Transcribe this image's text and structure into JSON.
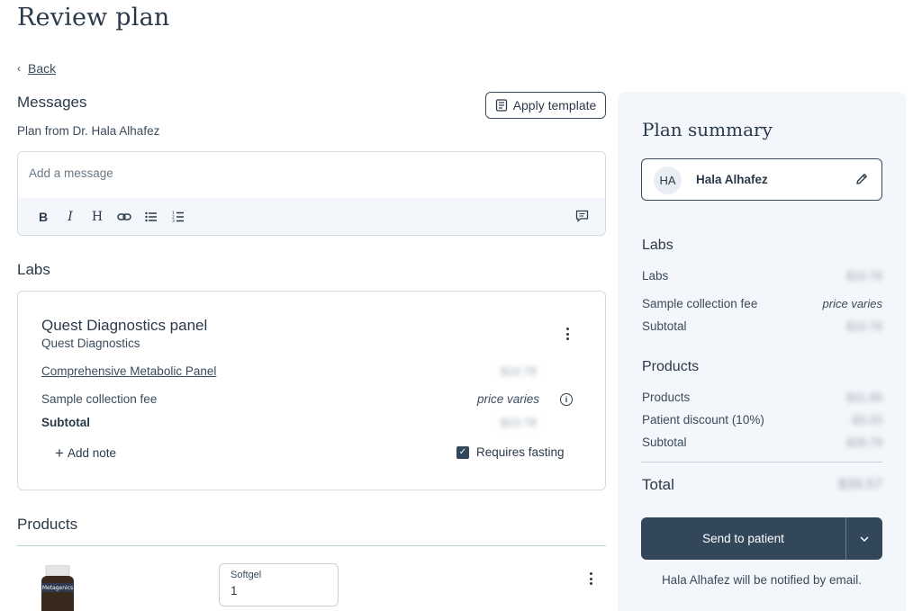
{
  "page": {
    "title": "Review plan",
    "back_label": "Back"
  },
  "messages": {
    "heading": "Messages",
    "from_text": "Plan from Dr. Hala Alhafez",
    "apply_template_label": "Apply template",
    "placeholder": "Add a message",
    "toolbar": {
      "bold": "B",
      "italic": "I",
      "heading": "H"
    }
  },
  "labs": {
    "heading": "Labs",
    "panel": {
      "title": "Quest Diagnostics panel",
      "provider": "Quest Diagnostics",
      "test_name": "Comprehensive Metabolic Panel",
      "test_price": "$10.78",
      "fee_label": "Sample collection fee",
      "fee_value": "price varies",
      "subtotal_label": "Subtotal",
      "subtotal_value": "$10.78",
      "add_note_label": "Add note",
      "requires_fasting_label": "Requires fasting",
      "requires_fasting": true
    }
  },
  "products": {
    "heading": "Products",
    "items": [
      {
        "brand": "Metagenics",
        "form_label": "Softgel",
        "quantity": "1"
      }
    ]
  },
  "summary": {
    "title": "Plan summary",
    "patient": {
      "initials": "HA",
      "name": "Hala Alhafez"
    },
    "labs": {
      "heading": "Labs",
      "rows": [
        {
          "label": "Labs",
          "value": "$10.78"
        },
        {
          "label": "Sample collection fee",
          "value": "price varies"
        },
        {
          "label": "Subtotal",
          "value": "$10.78"
        }
      ]
    },
    "products": {
      "heading": "Products",
      "rows": [
        {
          "label": "Products",
          "value": "$31.99"
        },
        {
          "label": "Patient discount (10%)",
          "value": "-$3.20"
        },
        {
          "label": "Subtotal",
          "value": "$28.79"
        }
      ]
    },
    "total_label": "Total",
    "total_value": "$39.57",
    "send_label": "Send to patient",
    "notify_text": "Hala Alhafez will be notified by email."
  },
  "colors": {
    "primary_dark": "#33475b",
    "panel_bg": "#f3f6fa",
    "border": "#d3dbe3",
    "products_rule": "#b9d1c9"
  }
}
